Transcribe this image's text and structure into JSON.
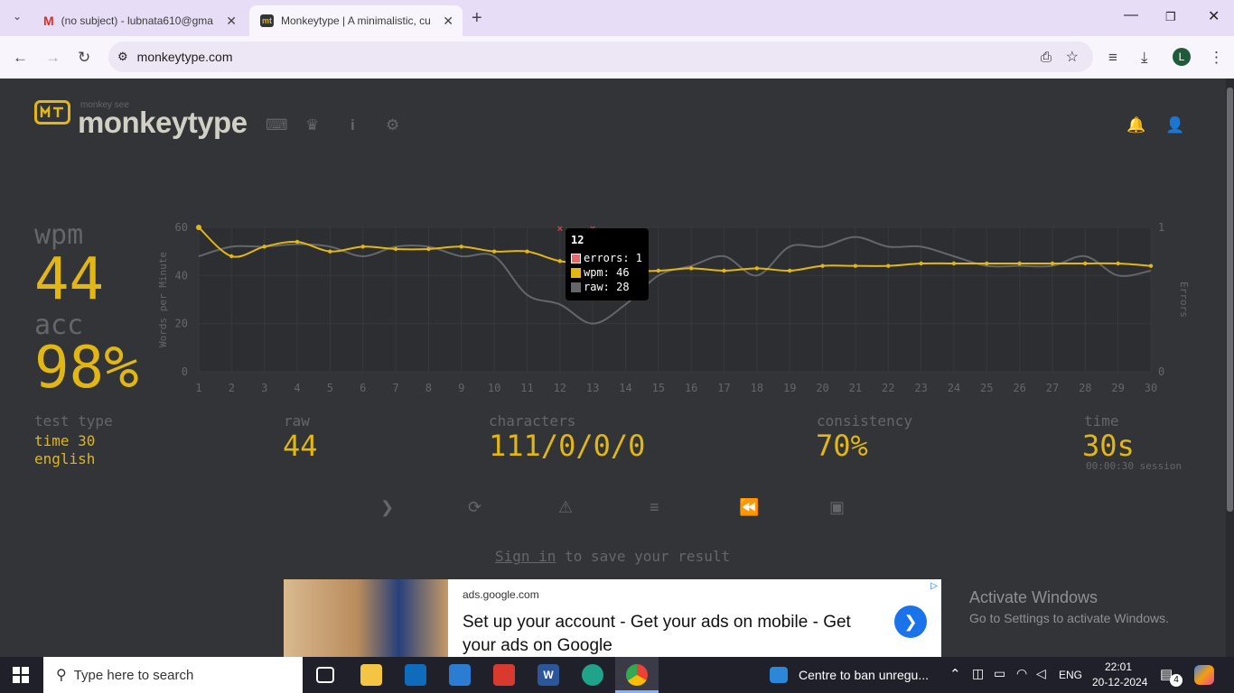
{
  "browser": {
    "tabs": [
      {
        "title": "(no subject) - lubnata610@gma",
        "icon": "gmail-icon"
      },
      {
        "title": "Monkeytype | A minimalistic, cu",
        "icon": "monkeytype-icon"
      }
    ],
    "url": "monkeytype.com",
    "profile_initial": "L"
  },
  "app": {
    "logo_sub": "monkey see",
    "logo_text": "monkeytype",
    "wpm_label": "wpm",
    "wpm_value": "44",
    "acc_label": "acc",
    "acc_value": "98%",
    "test_type_label": "test type",
    "test_type_1": "time 30",
    "test_type_2": "english",
    "raw_label": "raw",
    "raw_value": "44",
    "characters_label": "characters",
    "characters_value": "111/0/0/0",
    "consistency_label": "consistency",
    "consistency_value": "70%",
    "time_label": "time",
    "time_value": "30s",
    "session": "00:00:30 session",
    "sign_in": "Sign in",
    "save_text": " to save your result",
    "tooltip": {
      "title": "12",
      "errors": "errors: 1",
      "wpm": "wpm: 46",
      "raw": "raw: 28"
    }
  },
  "chart_data": {
    "type": "line",
    "xlabel": "",
    "ylabel": "Words per Minute",
    "y2label": "Errors",
    "x": [
      1,
      2,
      3,
      4,
      5,
      6,
      7,
      8,
      9,
      10,
      11,
      12,
      13,
      14,
      15,
      16,
      17,
      18,
      19,
      20,
      21,
      22,
      23,
      24,
      25,
      26,
      27,
      28,
      29,
      30
    ],
    "ylim": [
      0,
      60
    ],
    "y_ticks": [
      0,
      20,
      40,
      60
    ],
    "y2_ticks": [
      0,
      1
    ],
    "series": [
      {
        "name": "wpm",
        "color": "#e2b714",
        "values": [
          60,
          48,
          52,
          54,
          50,
          52,
          51,
          51,
          52,
          50,
          50,
          46,
          45,
          42,
          42,
          43,
          42,
          43,
          42,
          44,
          44,
          44,
          45,
          45,
          45,
          45,
          45,
          45,
          45,
          44
        ]
      },
      {
        "name": "raw",
        "color": "#646669",
        "values": [
          48,
          52,
          52,
          53,
          52,
          48,
          52,
          52,
          48,
          48,
          32,
          28,
          20,
          28,
          40,
          44,
          48,
          40,
          52,
          52,
          56,
          52,
          52,
          48,
          44,
          44,
          44,
          48,
          40,
          42
        ]
      },
      {
        "name": "errors",
        "color": "#ca4754",
        "values": [
          0,
          0,
          0,
          0,
          0,
          0,
          0,
          0,
          0,
          0,
          0,
          1,
          1,
          0,
          0,
          0,
          0,
          0,
          0,
          0,
          0,
          0,
          0,
          0,
          0,
          0,
          0,
          0,
          0,
          0
        ]
      }
    ]
  },
  "ad": {
    "domain": "ads.google.com",
    "headline": "Set up your account - Get your ads on mobile - Get your ads on Google"
  },
  "watermark": {
    "title": "Activate Windows",
    "sub": "Go to Settings to activate Windows."
  },
  "taskbar": {
    "search": "Type here to search",
    "notif": "Centre to ban unregu...",
    "lang": "ENG",
    "time": "22:01",
    "date": "20-12-2024",
    "badge": "4"
  }
}
